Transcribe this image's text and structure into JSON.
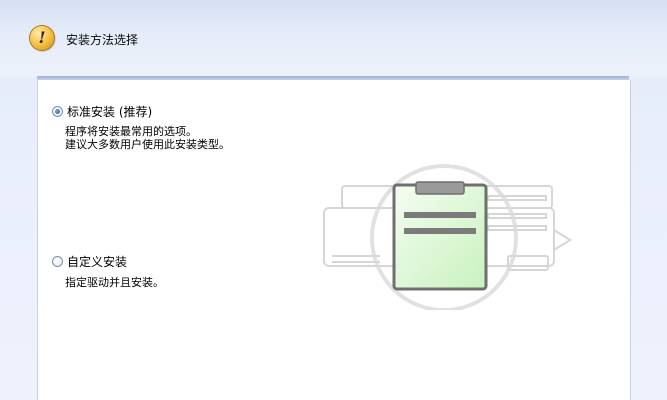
{
  "header": {
    "icon": "warning-icon",
    "icon_glyph": "!",
    "title": "安装方法选择"
  },
  "options": [
    {
      "label": "标准安装 (推荐)",
      "selected": true,
      "description_lines": [
        "程序将安装最常用的选项。",
        "建议大多数用户使用此安装类型。"
      ]
    },
    {
      "label": "自定义安装",
      "selected": false,
      "description_lines": [
        "指定驱动并且安装。"
      ]
    }
  ],
  "illustration": {
    "icon": "clipboard-printer-illustration"
  },
  "colors": {
    "accent_rule": "#9fb0d6",
    "clipboard_fill": "#d9f7d2",
    "clipboard_border": "#6d6d6d"
  }
}
